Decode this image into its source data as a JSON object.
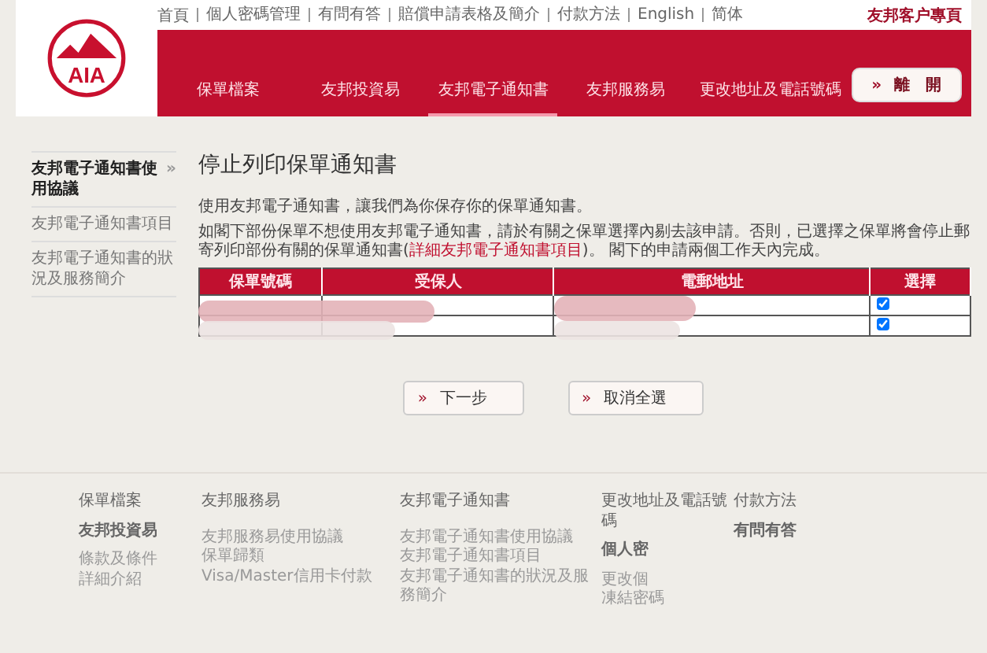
{
  "logo": "AIA",
  "top_links": [
    "首頁",
    "個人密碼管理",
    "有問有答",
    "賠償申請表格及簡介",
    "付款方法",
    "English",
    "简体"
  ],
  "portal_title": "友邦客户專頁",
  "tabs": [
    {
      "label": "保單檔案",
      "selected": false
    },
    {
      "label": "友邦投資易",
      "selected": false
    },
    {
      "label": "友邦電子通知書",
      "selected": true
    },
    {
      "label": "友邦服務易",
      "selected": false
    },
    {
      "label": "更改地址及電話號碼",
      "selected": false
    }
  ],
  "logout_button": {
    "icon": "»",
    "label": "離　開"
  },
  "sidebar": {
    "items": [
      {
        "label": "友邦電子通知書使用協議",
        "selected": true,
        "icon": "»"
      },
      {
        "label": "友邦電子通知書項目",
        "selected": false
      },
      {
        "label": "友邦電子通知書的狀況及服務簡介",
        "selected": false
      }
    ]
  },
  "page_title": "停止列印保單通知書",
  "paragraphs": [
    "使用友邦電子通知書，讓我們為你保存你的保單通知書。",
    "如閣下部份保單不想使用友邦電子通知書，請於有關之保單選擇內剔去該申請。否則，已選擇之保單將會停止郵寄列印部份有關的保單通知書(**詳細友邦電子通知書項目**)。 閣下的申請兩個工作天內完成。"
  ],
  "table": {
    "columns": [
      "保單號碼",
      "受保人",
      "電郵地址",
      "選擇"
    ],
    "rows": [
      {
        "checked": true
      },
      {
        "checked": true
      }
    ]
  },
  "buttons": [
    {
      "icon": "»",
      "label": "下一步"
    },
    {
      "icon": "»",
      "label": "取消全選"
    }
  ],
  "footer": [
    {
      "heading": "保單檔案",
      "subheading": "友邦投資易",
      "links": [
        "條款及條件",
        "詳細介紹"
      ]
    },
    {
      "heading": "友邦服務易",
      "links": [
        "友邦服務易使用協議",
        "保單歸類",
        "Visa/Master信用卡付款"
      ]
    },
    {
      "heading": "友邦電子通知書",
      "links": [
        "友邦電子通知書使用協議",
        "友邦電子通知書項目",
        "友邦電子通知書的狀況及服務簡介"
      ]
    },
    {
      "heading": "更改地址及電話號碼",
      "subheading": "個人密",
      "links": [
        "更改個",
        "凍結密碼"
      ]
    },
    {
      "heading": "付款方法",
      "subheading": "有問有答"
    }
  ]
}
